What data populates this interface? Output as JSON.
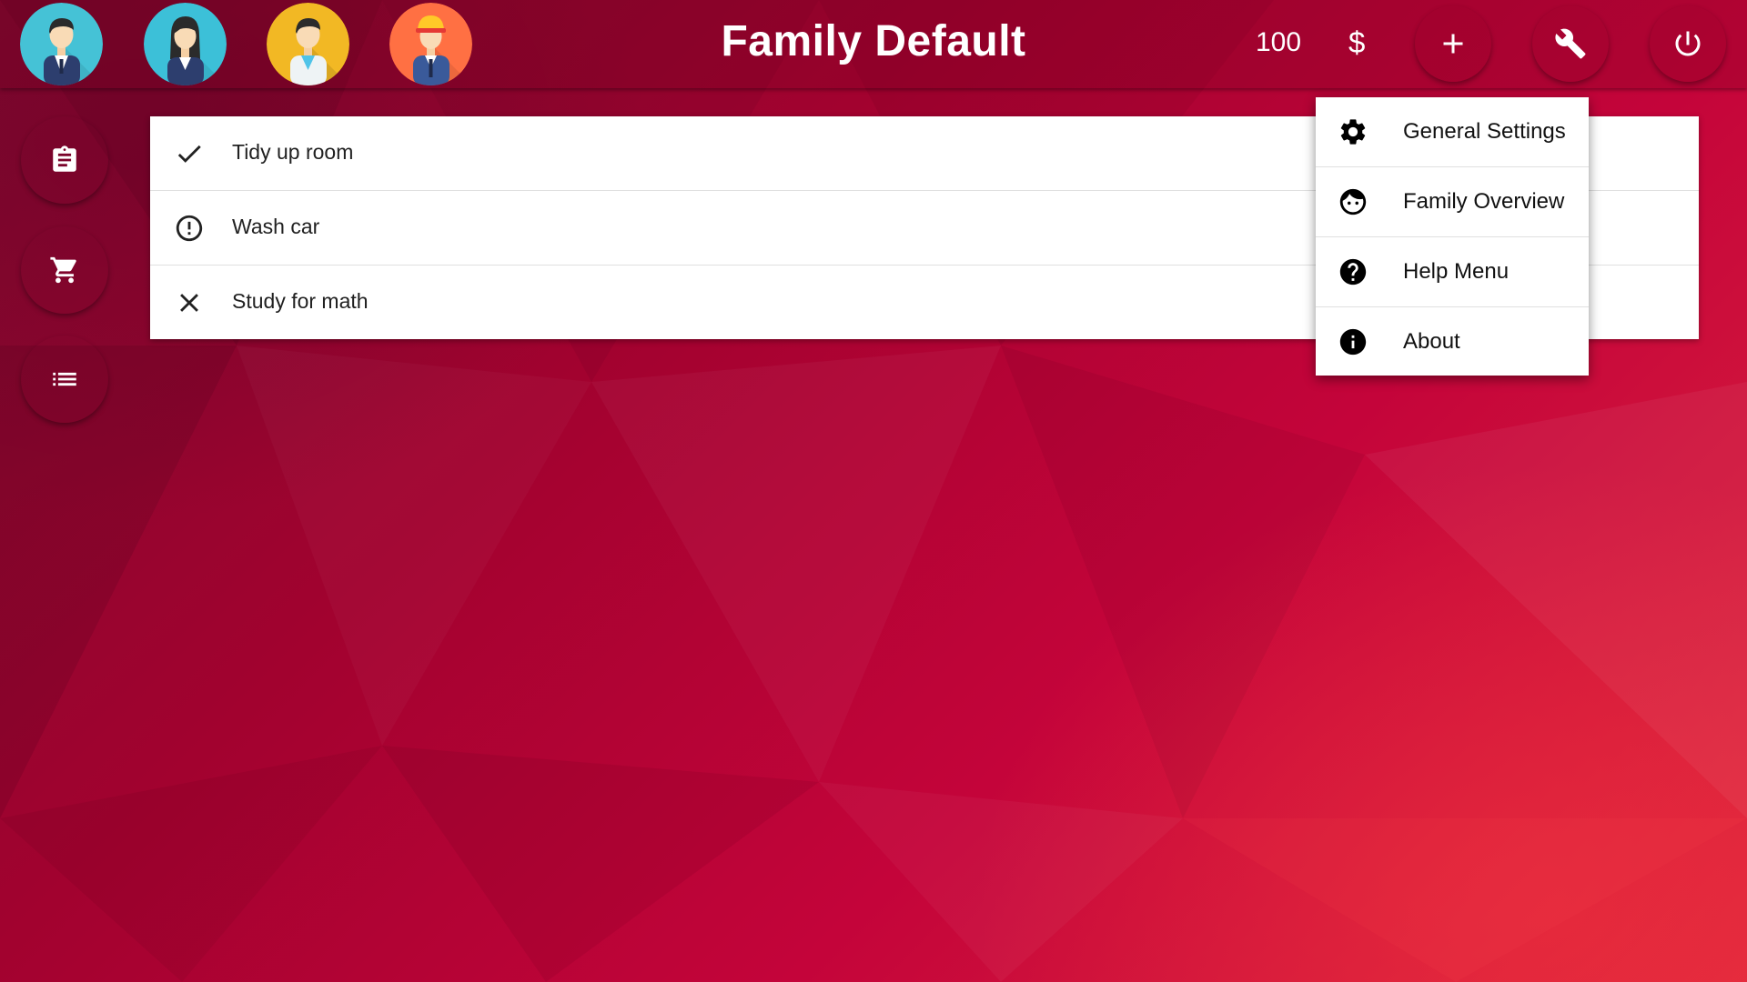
{
  "header": {
    "title": "Family Default",
    "balance": "100",
    "currency_symbol": "$",
    "avatars": [
      {
        "icon": "father-avatar-icon",
        "bg": "#45c2d6"
      },
      {
        "icon": "mother-avatar-icon",
        "bg": "#3cc0d8"
      },
      {
        "icon": "boy-avatar-icon",
        "bg": "#f2b824"
      },
      {
        "icon": "worker-avatar-icon",
        "bg": "#ff7043"
      }
    ],
    "buttons": [
      "plus-icon",
      "wrench-icon",
      "power-icon"
    ]
  },
  "sidebar": {
    "items": [
      {
        "icon": "clipboard-icon"
      },
      {
        "icon": "shopping-cart-icon"
      },
      {
        "icon": "list-icon"
      }
    ]
  },
  "tasks": [
    {
      "label": "Tidy up room",
      "status_icon": "check-icon"
    },
    {
      "label": "Wash car",
      "status_icon": "alert-circle-icon"
    },
    {
      "label": "Study for math",
      "status_icon": "close-icon"
    }
  ],
  "menu": {
    "items": [
      {
        "label": "General Settings",
        "icon": "gear-icon"
      },
      {
        "label": "Family Overview",
        "icon": "face-icon"
      },
      {
        "label": "Help Menu",
        "icon": "help-circle-icon"
      },
      {
        "label": "About",
        "icon": "info-icon"
      }
    ]
  },
  "colors": {
    "background_dark": "#7d0a2e",
    "background_mid": "#c4043a",
    "background_light": "#e0283e",
    "surface": "#ffffff"
  }
}
